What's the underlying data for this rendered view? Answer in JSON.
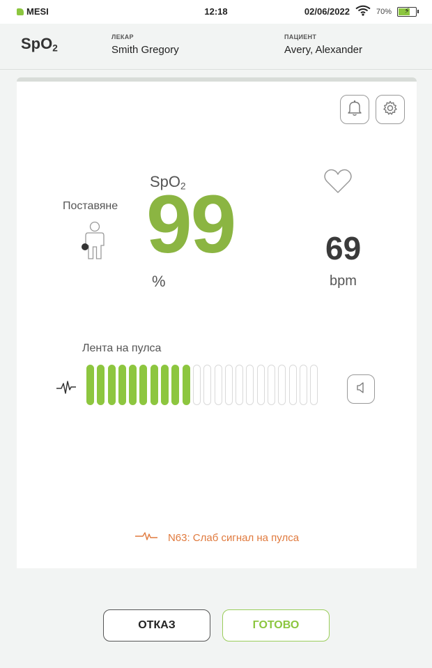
{
  "status_bar": {
    "brand": "MESI",
    "time": "12:18",
    "date": "02/06/2022",
    "battery_percent": "70%",
    "battery_level": 0.7
  },
  "header": {
    "title_main": "SpO",
    "title_sub": "2",
    "doctor_caption": "ЛЕКАР",
    "doctor_name": "Smith Gregory",
    "patient_caption": "ПАЦИЕНТ",
    "patient_name": "Avery, Alexander"
  },
  "measurement": {
    "spo2_label_main": "SpO",
    "spo2_label_sub": "2",
    "placement_label": "Поставяне",
    "spo2_value": "99",
    "spo2_unit": "%",
    "pulse_value": "69",
    "pulse_unit": "bpm"
  },
  "pulse_strip": {
    "label": "Лента на пулса",
    "active_bars": 10,
    "total_bars": 22
  },
  "warning": {
    "text": "N63: Слаб сигнал на пулса"
  },
  "buttons": {
    "cancel": "ОТКАЗ",
    "done": "ГОТОВО"
  },
  "colors": {
    "accent_green": "#8dc63f",
    "spo2_green": "#8bb542",
    "warning_orange": "#e07a3e"
  },
  "icons": {
    "bell": "bell-icon",
    "settings": "gear-icon",
    "heart": "heart-icon",
    "placement": "body-figure-icon",
    "pulse": "pulse-wave-icon",
    "speaker": "speaker-icon"
  }
}
